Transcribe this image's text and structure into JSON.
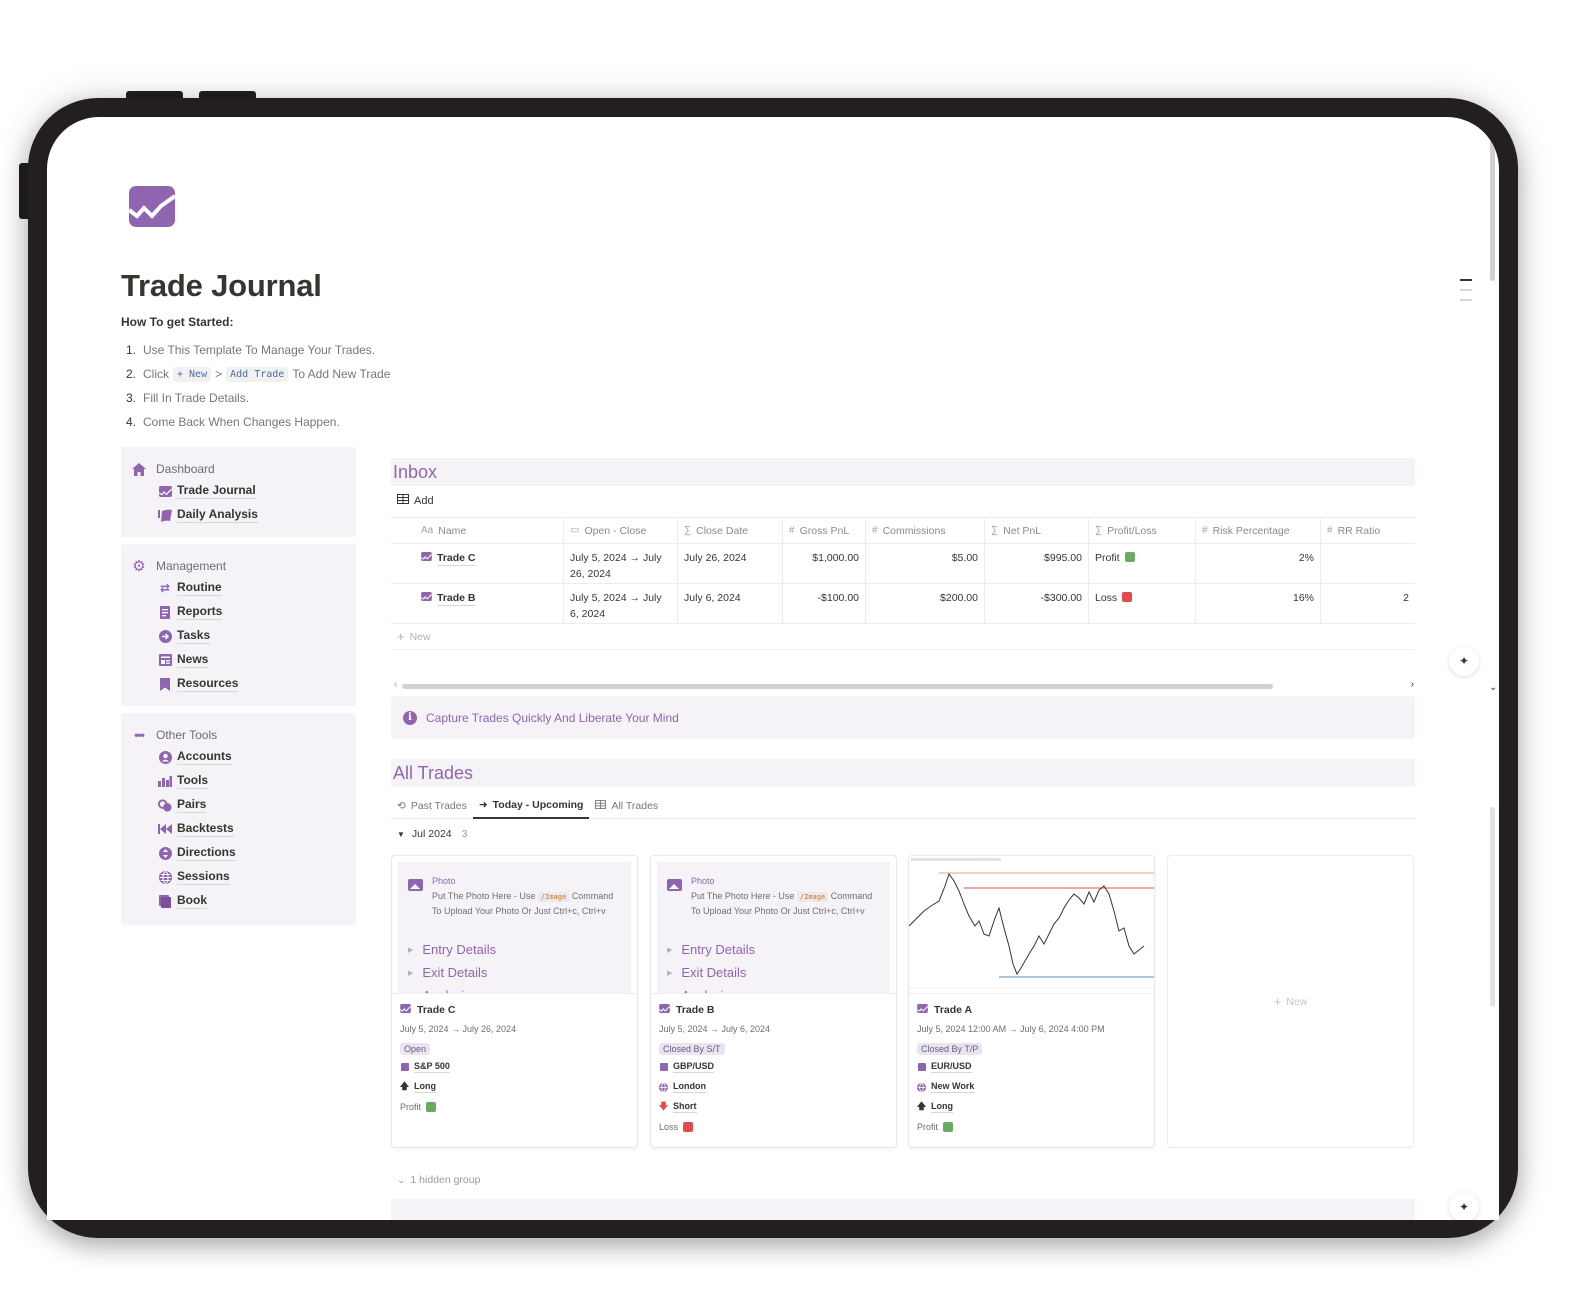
{
  "page": {
    "title": "Trade Journal",
    "subtitle": "How To get Started:",
    "steps": [
      {
        "num": "1.",
        "text": "Use This Template To Manage Your Trades."
      },
      {
        "num": "2.",
        "pre": "Click",
        "code1": "+ New",
        "sep": ">",
        "code2": "Add Trade",
        "post": "To Add New Trade"
      },
      {
        "num": "3.",
        "text": "Fill In Trade Details."
      },
      {
        "num": "4.",
        "text": "Come Back When Changes Happen."
      }
    ]
  },
  "sidebar": {
    "groups": [
      {
        "label": "Dashboard",
        "icon": "home-icon",
        "items": [
          {
            "label": "Trade Journal",
            "icon": "chart-icon"
          },
          {
            "label": "Daily Analysis",
            "icon": "analysis-icon"
          }
        ]
      },
      {
        "label": "Management",
        "icon": "gear-icon",
        "items": [
          {
            "label": "Routine",
            "icon": "repeat-icon"
          },
          {
            "label": "Reports",
            "icon": "report-icon"
          },
          {
            "label": "Tasks",
            "icon": "arrow-circle-icon"
          },
          {
            "label": "News",
            "icon": "newspaper-icon"
          },
          {
            "label": "Resources",
            "icon": "bookmark-icon"
          }
        ]
      },
      {
        "label": "Other Tools",
        "icon": "more-icon",
        "items": [
          {
            "label": "Accounts",
            "icon": "user-circle-icon"
          },
          {
            "label": "Tools",
            "icon": "tools-icon"
          },
          {
            "label": "Pairs",
            "icon": "coins-icon"
          },
          {
            "label": "Backtests",
            "icon": "rewind-icon"
          },
          {
            "label": "Directions",
            "icon": "directions-icon"
          },
          {
            "label": "Sessions",
            "icon": "globe-icon"
          },
          {
            "label": "Book",
            "icon": "book-icon"
          }
        ]
      }
    ]
  },
  "inbox": {
    "title": "Inbox",
    "add_label": "Add",
    "columns": [
      {
        "icon": "Aa",
        "label": "Name"
      },
      {
        "icon": "▭",
        "label": "Open - Close"
      },
      {
        "icon": "∑",
        "label": "Close Date"
      },
      {
        "icon": "#",
        "label": "Gross PnL"
      },
      {
        "icon": "#",
        "label": "Commissions"
      },
      {
        "icon": "∑",
        "label": "Net PnL"
      },
      {
        "icon": "∑",
        "label": "Profit/Loss"
      },
      {
        "icon": "#",
        "label": "Risk Percentage"
      },
      {
        "icon": "#",
        "label": "RR Ratio"
      }
    ],
    "rows": [
      {
        "name": "Trade C",
        "open_close": "July 5, 2024 → July 26, 2024",
        "close_date": "July 26, 2024",
        "gross_pnl": "$1,000.00",
        "commissions": "$5.00",
        "net_pnl": "$995.00",
        "profit_loss": "Profit",
        "pl_color": "#6aaa64",
        "risk": "2%",
        "rr": ""
      },
      {
        "name": "Trade B",
        "open_close": "July 5, 2024 → July 6, 2024",
        "close_date": "July 6, 2024",
        "gross_pnl": "-$100.00",
        "commissions": "$200.00",
        "net_pnl": "-$300.00",
        "profit_loss": "Loss",
        "pl_color": "#e5484d",
        "risk": "16%",
        "rr": "2"
      }
    ],
    "new_label": "New"
  },
  "callout1": {
    "text": "Capture Trades Quickly And Liberate Your Mind"
  },
  "all_trades": {
    "title": "All Trades",
    "tabs": [
      {
        "label": "Past Trades",
        "icon": "history-icon",
        "active": false
      },
      {
        "label": "Today - Upcoming",
        "icon": "arrow-right-icon",
        "active": true
      },
      {
        "label": "All Trades",
        "icon": "table-icon",
        "active": false
      }
    ],
    "group": {
      "label": "Jul 2024",
      "count": "3"
    },
    "photo": {
      "title": "Photo",
      "desc_pre": "Put The Photo Here - Use",
      "desc_code": "/Image",
      "desc_post": "Command",
      "desc_line2": "To Upload Your Photo Or Just Ctrl+c, Ctrl+v"
    },
    "toggles": [
      "Entry Details",
      "Exit Details",
      "Analysis"
    ],
    "cards": [
      {
        "name": "Trade C",
        "dates": "July 5, 2024 → July 26, 2024",
        "status": "Open",
        "pair": "S&P 500",
        "session": "",
        "direction": "Long",
        "direction_icon": "arrow-up-icon",
        "result": "Profit",
        "result_color": "#6aaa64"
      },
      {
        "name": "Trade B",
        "dates": "July 5, 2024 → July 6, 2024",
        "status": "Closed By S/T",
        "pair": "GBP/USD",
        "session": "London",
        "direction": "Short",
        "direction_icon": "arrow-down-icon",
        "result": "Loss",
        "result_color": "#e5484d"
      },
      {
        "name": "Trade A",
        "dates": "July 5, 2024 12:00 AM → July 6, 2024 4:00 PM",
        "status": "Closed By T/P",
        "pair": "EUR/USD",
        "session": "New Work",
        "direction": "Long",
        "direction_icon": "arrow-up-icon",
        "result": "Profit",
        "result_color": "#6aaa64"
      }
    ],
    "new_card_label": "New",
    "hidden_group": "1 hidden group"
  },
  "colors": {
    "accent": "#9065b0",
    "accent_bg": "#f5f3f8",
    "profit": "#6aaa64",
    "loss": "#e5484d",
    "text": "#37352f",
    "muted": "#787774"
  }
}
